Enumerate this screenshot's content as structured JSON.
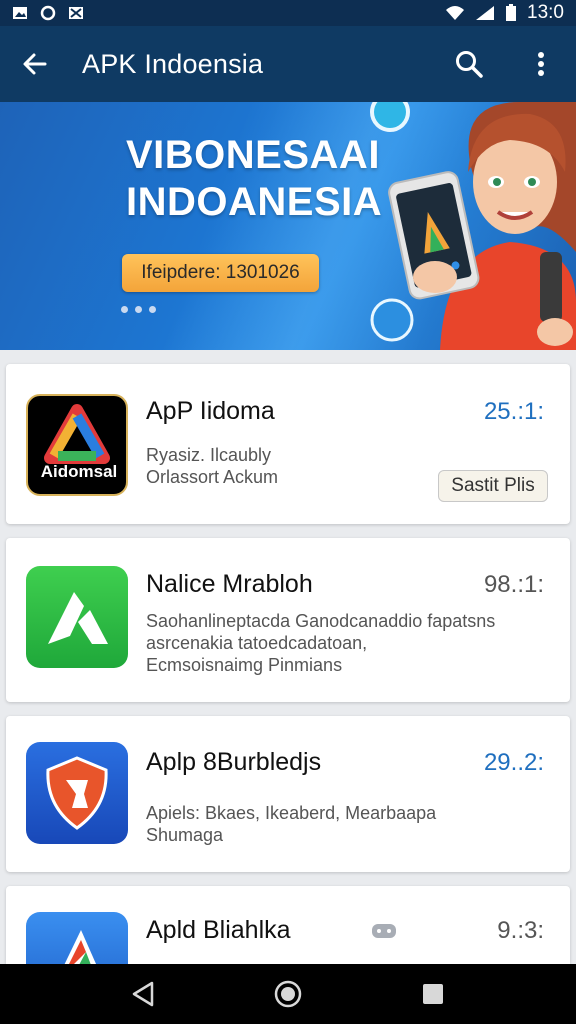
{
  "status_bar": {
    "time": "13:0"
  },
  "app_bar": {
    "title": "APK Indoensia"
  },
  "banner": {
    "title_line1": "VIBONESAAI",
    "title_line2": "INDOANESIA",
    "badge_text": "Ifeipdere: 1301026"
  },
  "apps": [
    {
      "name": "ApP Iidoma",
      "rating": "25.:1:",
      "rating_color": "#1f6fbf",
      "desc_lines": [
        "Ryasiz. Ilcaubly",
        "Orlassort Ackum"
      ],
      "button": "Sastit Plis",
      "icon_label": "Aidomsal"
    },
    {
      "name": "Nalice Mrabloh",
      "rating": "98.:1:",
      "rating_color": "#555555",
      "desc_lines": [
        "Saohanlineptacda Ganodcanaddio fapatsns",
        "asrcenakia tatoedcadatoan,",
        "Ecmsoisnaimg Pinmians"
      ]
    },
    {
      "name": "Aplp 8Burbledjs",
      "rating": "29..2:",
      "rating_color": "#1f6fbf",
      "desc_lines": [
        "Apiels: Bkaes, Ikeaberd, Mearbaapa",
        "Shumaga"
      ]
    },
    {
      "name": "Apld Bliahlka",
      "rating": "9.:3:",
      "rating_color": "#555555",
      "desc_lines": []
    }
  ]
}
